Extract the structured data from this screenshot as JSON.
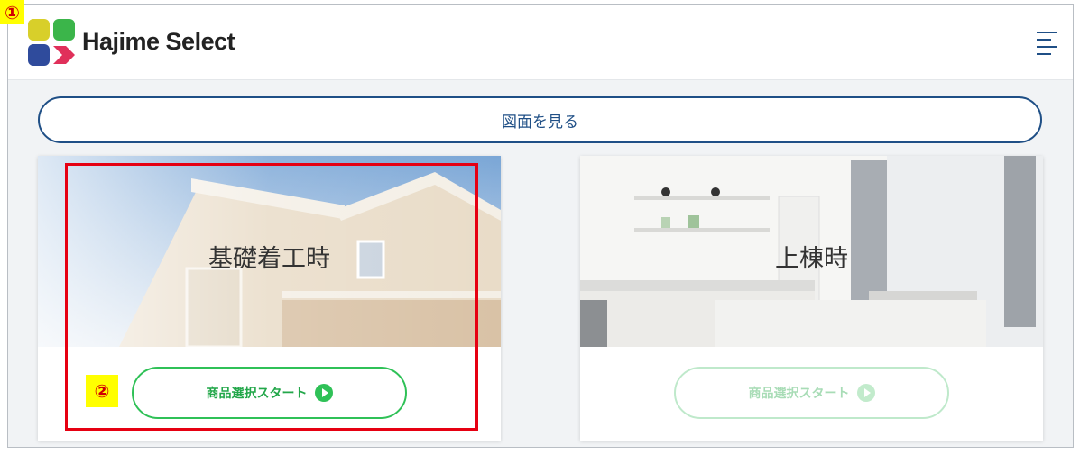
{
  "header": {
    "brand": "Hajime Select",
    "logo_colors": [
      "#d8cf2a",
      "#3bb54a",
      "#2f4b9c",
      "#e0305a"
    ]
  },
  "view_button": {
    "label": "図面を見る"
  },
  "cards": [
    {
      "title": "基礎着工時",
      "button_label": "商品選択スタート",
      "enabled": true
    },
    {
      "title": "上棟時",
      "button_label": "商品選択スタート",
      "enabled": false
    }
  ],
  "annotations": {
    "badge1": "①",
    "badge2": "②"
  },
  "colors": {
    "primary": "#1f4f86",
    "green": "#2fc157",
    "highlight": "#e60012"
  }
}
